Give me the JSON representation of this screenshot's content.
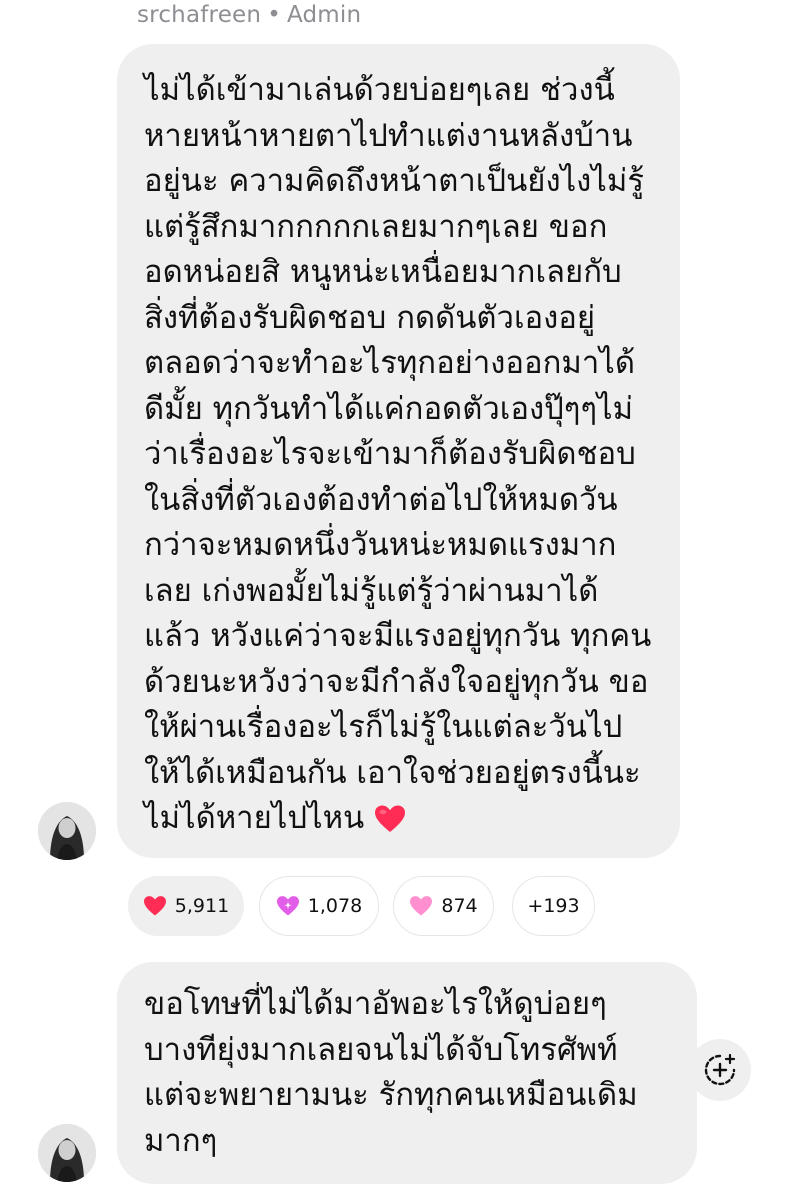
{
  "header": {
    "sender_name": "srchafreen",
    "separator": "•",
    "role": "Admin"
  },
  "messages": [
    {
      "lines": [
        "ไม่ได้เข้ามาเล่นด้วยบ่อยๆเลย ช่วงนี้",
        "หายหน้าหายตาไปทำแต่งานหลังบ้าน",
        "อยู่นะ ความคิดถึงหน้าตาเป็นยังไงไม่รู้",
        "แต่รู้สึกมากกกกกเลยมากๆเลย ขอก",
        "อดหน่อยสิ หนูหน่ะเหนื่อยมากเลยกับ",
        "สิ่งที่ต้องรับผิดชอบ กดดันตัวเองอยู่",
        "ตลอดว่าจะทำอะไรทุกอย่างออกมาได้",
        "ดีมั้ย ทุกวันทำได้แค่กอดตัวเองปุ๊ๆๆไม่",
        "ว่าเรื่องอะไรจะเข้ามาก็ต้องรับผิดชอบ",
        "ในสิ่งที่ตัวเองต้องทำต่อไปให้หมดวัน",
        "กว่าจะหมดหนึ่งวันหน่ะหมดแรงมาก",
        "เลย เก่งพอมั้ยไม่รู้แต่รู้ว่าผ่านมาได้",
        "แล้ว หวังแค่ว่าจะมีแรงอยู่ทุกวัน ทุกคน",
        "ด้วยนะหวังว่าจะมีกำลังใจอยู่ทุกวัน ขอ",
        "ให้ผ่านเรื่องอะไรก็ไม่รู้ในแต่ละวันไป",
        "ให้ได้เหมือนกัน เอาใจช่วยอยู่ตรงนี้นะ",
        "ไม่ได้หายไปไหน"
      ],
      "trailing_emoji": "red-heart-emoji",
      "reactions": [
        {
          "icon": "red-heart-icon",
          "color": "#ff2d55",
          "count": "5,911"
        },
        {
          "icon": "sparkling-heart-icon",
          "color": "#e35ee8",
          "count": "1,078"
        },
        {
          "icon": "pink-heart-icon",
          "color": "#ff8fcf",
          "count": "874"
        },
        {
          "count": "+193"
        }
      ]
    },
    {
      "lines": [
        "ขอโทษที่ไม่ได้มาอัพอะไรให้ดูบ่อยๆ",
        "บางทียุ่งมากเลยจนไม่ได้จับโทรศัพท์",
        "แต่จะพยายามนะ รักทุกคนเหมือนเดิม",
        "มากๆ"
      ]
    }
  ],
  "colors": {
    "bubble_bg": "#efefef",
    "meta_text": "#8e8e93",
    "heart_red": "#ff2d55"
  }
}
